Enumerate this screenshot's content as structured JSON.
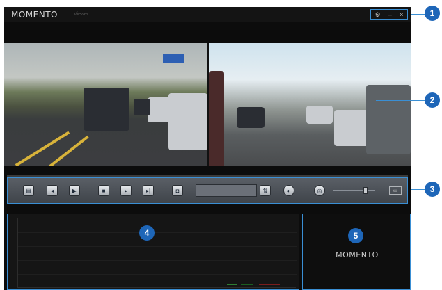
{
  "app": {
    "logo": "MOMENTO",
    "subtitle": "Viewer"
  },
  "window_controls": {
    "settings_icon": "gear-icon",
    "minimize": "–",
    "close": "×"
  },
  "callouts": {
    "c1": "1",
    "c2": "2",
    "c3": "3",
    "c4": "4",
    "c5": "5"
  },
  "video": {
    "front_icon": "front-camera-view",
    "rear_icon": "rear-camera-view",
    "playback_progress": 0.0
  },
  "toolbar": {
    "open_icon": "folder-icon",
    "prev_icon": "previous-icon",
    "play_icon": "play-icon",
    "stop_icon": "stop-icon",
    "step_icon": "step-forward-icon",
    "next_icon": "next-icon",
    "snapshot_icon": "snapshot-icon",
    "time": "",
    "flip_icon": "flip-icon",
    "brightness_icon": "brightness-icon",
    "map_icon": "map-icon",
    "volume_level": 0.8,
    "fullscreen": "▭"
  },
  "graph": {
    "title": ""
  },
  "logo_panel": {
    "logo": "MOMENTO"
  },
  "colors": {
    "accent": "#3a8fd4",
    "badge": "#1e66b8"
  }
}
